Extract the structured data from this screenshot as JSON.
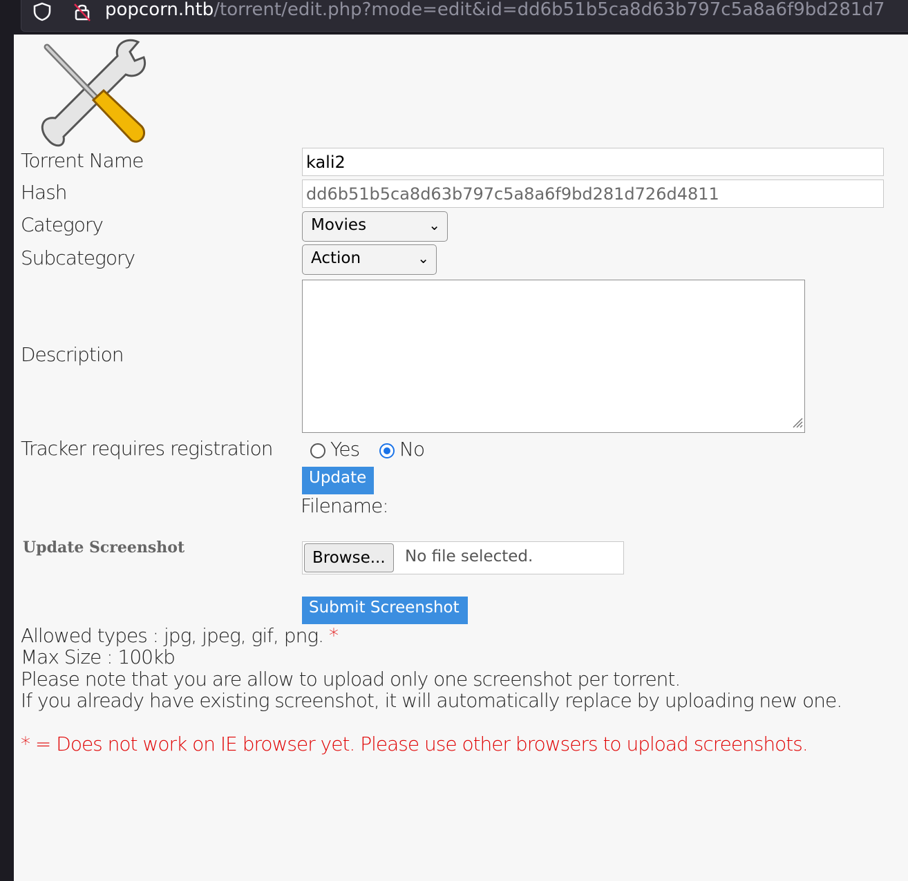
{
  "browser": {
    "url_host": "popcorn.htb",
    "url_path": "/torrent/edit.php?mode=edit&id=dd6b51b5ca8d63b797c5a8a6f9bd281d7"
  },
  "form": {
    "torrent_name_label": "Torrent Name",
    "torrent_name_value": "kali2",
    "hash_label": "Hash",
    "hash_value": "dd6b51b5ca8d63b797c5a8a6f9bd281d726d4811",
    "category_label": "Category",
    "category_value": "Movies",
    "subcategory_label": "Subcategory",
    "subcategory_value": "Action",
    "description_label": "Description",
    "description_value": "",
    "tracker_label": "Tracker requires registration",
    "yes_label": "Yes",
    "no_label": "No",
    "selected_tracker": "No",
    "update_button": "Update",
    "filename_label": "Filename:"
  },
  "screenshot": {
    "heading": "Update Screenshot",
    "browse_button": "Browse...",
    "no_file_text": "No file selected.",
    "submit_button": "Submit Screenshot",
    "allowed_types": "Allowed types :  jpg,  jpeg, gif, png.",
    "asterisk": "*",
    "max_size": "Max Size  :  100kb",
    "note1": "Please note that you are allow to upload only one screenshot per torrent.",
    "note2": "If you already have existing screenshot, it will automatically replace by uploading new one.",
    "warning": "= Does not work on IE browser yet. Please use other browsers to upload screenshots."
  },
  "colors": {
    "accent_button": "#3b8ee0",
    "warning_red": "#e00000",
    "page_bg": "#f7f7f7"
  }
}
